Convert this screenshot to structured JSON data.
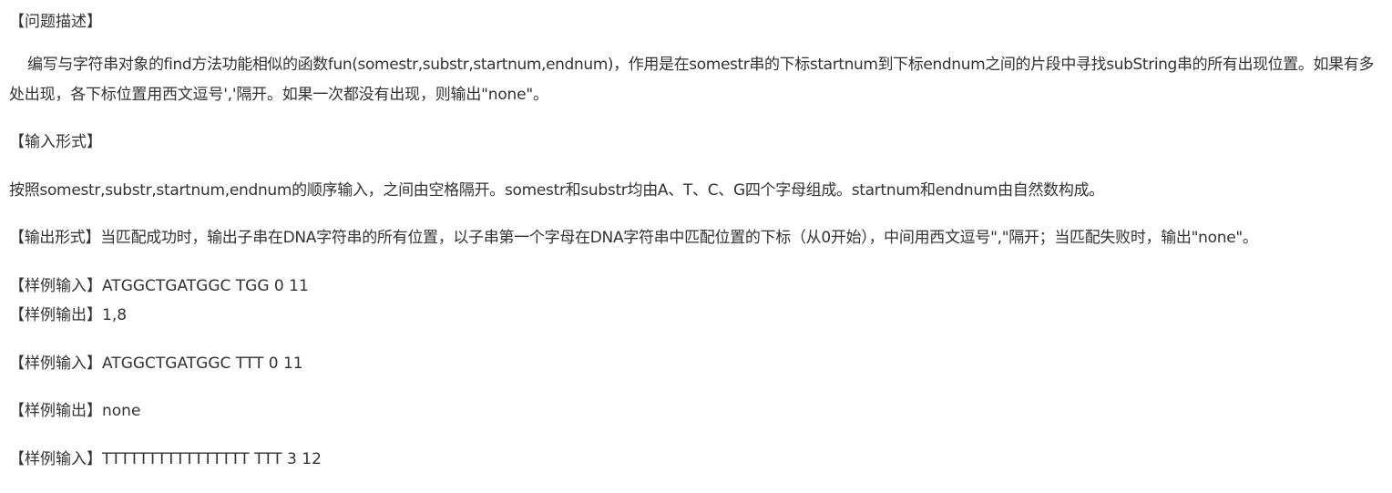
{
  "problem": {
    "heading": "【问题描述】",
    "desc_line1": "编写与字符串对象的find方法功能相似的函数fun(somestr,substr,startnum,endnum)，作用是在somestr串的下标startnum到下标endnum之间的片段中寻找subString串的所有出现位置。如果有多",
    "desc_line2": "处出现，各下标位置用西文逗号','隔开。如果一次都没有出现，则输出\"none\"。"
  },
  "input_format": {
    "heading": "【输入形式】",
    "text": "按照somestr,substr,startnum,endnum的顺序输入，之间由空格隔开。somestr和substr均由A、T、C、G四个字母组成。startnum和endnum由自然数构成。"
  },
  "output_format": {
    "text": "【输出形式】当匹配成功时，输出子串在DNA字符串的所有位置，以子串第一个字母在DNA字符串中匹配位置的下标（从0开始），中间用西文逗号\",\"隔开；当匹配失败时，输出\"none\"。"
  },
  "samples": [
    "【样例输入】ATGGCTGATGGC TGG 0 11",
    "【样例输出】1,8",
    "【样例输入】ATGGCTGATGGC TTT 0 11",
    "【样例输出】none",
    "【样例输入】TTTTTTTTTTTTTTTT TTT 3 12"
  ]
}
